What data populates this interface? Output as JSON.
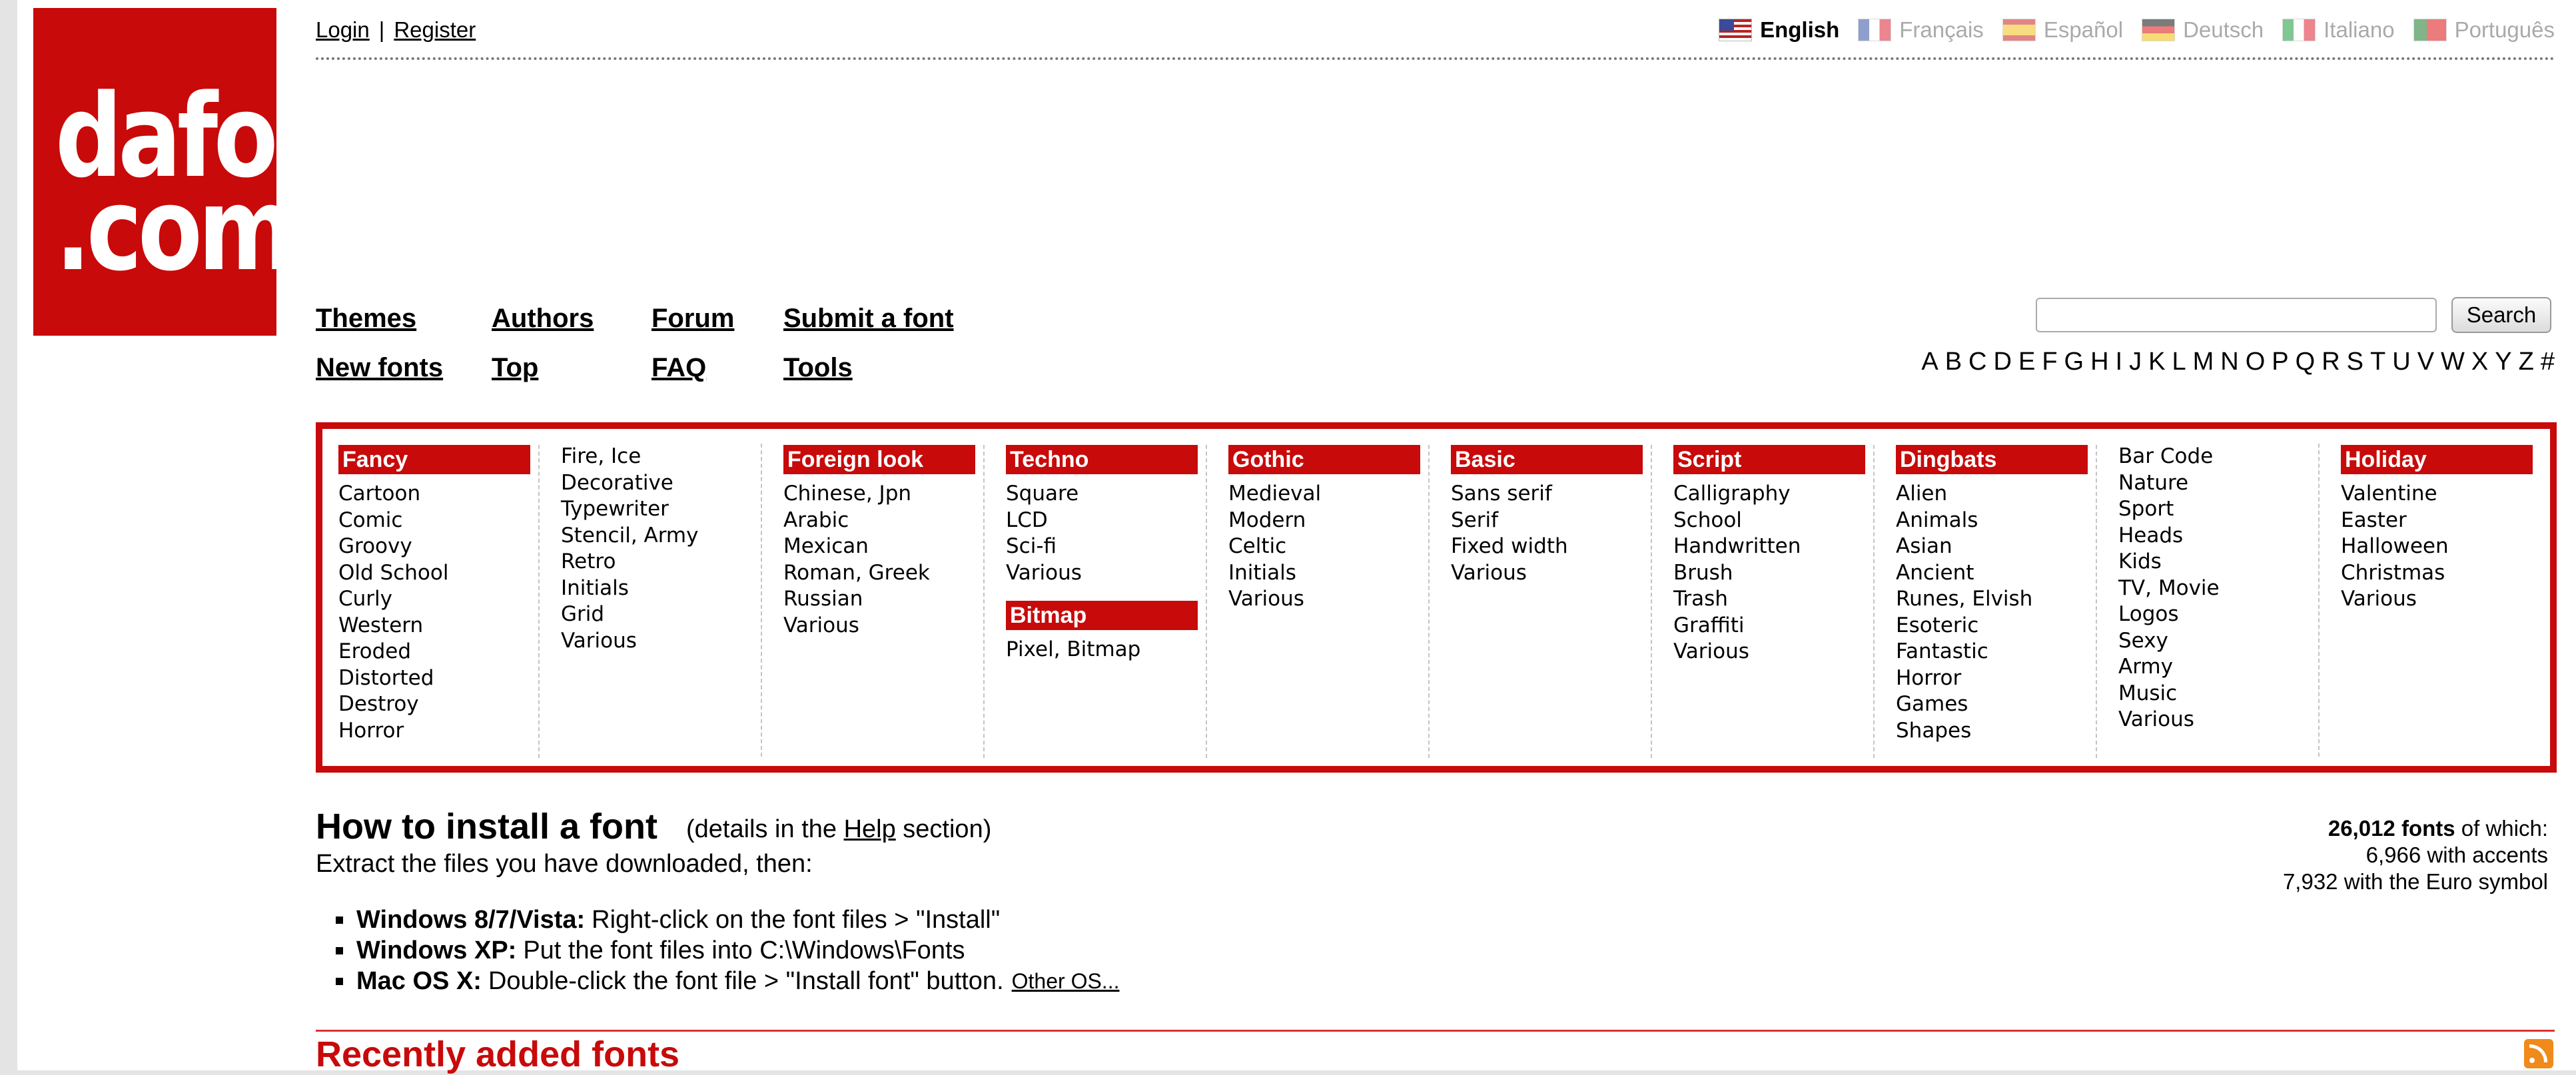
{
  "logo": {
    "line1": "dafont",
    "line2": ".com"
  },
  "top_links": {
    "login": "Login",
    "separator": "|",
    "register": "Register"
  },
  "languages": [
    {
      "name": "English",
      "flag": "us-flag",
      "active": true
    },
    {
      "name": "Français",
      "flag": "fr-flag",
      "active": false
    },
    {
      "name": "Español",
      "flag": "es-flag",
      "active": false
    },
    {
      "name": "Deutsch",
      "flag": "de-flag",
      "active": false
    },
    {
      "name": "Italiano",
      "flag": "it-flag",
      "active": false
    },
    {
      "name": "Português",
      "flag": "pt-flag",
      "active": false
    }
  ],
  "nav": {
    "themes": "Themes",
    "authors": "Authors",
    "forum": "Forum",
    "submit": "Submit a font",
    "new_fonts": "New fonts",
    "top": "Top",
    "faq": "FAQ",
    "tools": "Tools"
  },
  "search": {
    "value": "",
    "button": "Search"
  },
  "alphabet": [
    "A",
    "B",
    "C",
    "D",
    "E",
    "F",
    "G",
    "H",
    "I",
    "J",
    "K",
    "L",
    "M",
    "N",
    "O",
    "P",
    "Q",
    "R",
    "S",
    "T",
    "U",
    "V",
    "W",
    "X",
    "Y",
    "Z",
    "#"
  ],
  "categories": {
    "fancy": {
      "head": "Fancy",
      "items": [
        "Cartoon",
        "Comic",
        "Groovy",
        "Old School",
        "Curly",
        "Western",
        "Eroded",
        "Distorted",
        "Destroy",
        "Horror"
      ]
    },
    "fancy2": {
      "items": [
        "Fire, Ice",
        "Decorative",
        "Typewriter",
        "Stencil, Army",
        "Retro",
        "Initials",
        "Grid",
        "Various"
      ]
    },
    "foreign": {
      "head": "Foreign look",
      "items": [
        "Chinese, Jpn",
        "Arabic",
        "Mexican",
        "Roman, Greek",
        "Russian",
        "Various"
      ]
    },
    "techno": {
      "head": "Techno",
      "items": [
        "Square",
        "LCD",
        "Sci-fi",
        "Various"
      ]
    },
    "bitmap": {
      "head": "Bitmap",
      "items": [
        "Pixel, Bitmap"
      ]
    },
    "gothic": {
      "head": "Gothic",
      "items": [
        "Medieval",
        "Modern",
        "Celtic",
        "Initials",
        "Various"
      ]
    },
    "basic": {
      "head": "Basic",
      "items": [
        "Sans serif",
        "Serif",
        "Fixed width",
        "Various"
      ]
    },
    "script": {
      "head": "Script",
      "items": [
        "Calligraphy",
        "School",
        "Handwritten",
        "Brush",
        "Trash",
        "Graffiti",
        "Various"
      ]
    },
    "dingbats": {
      "head": "Dingbats",
      "items": [
        "Alien",
        "Animals",
        "Asian",
        "Ancient",
        "Runes, Elvish",
        "Esoteric",
        "Fantastic",
        "Horror",
        "Games",
        "Shapes"
      ]
    },
    "dingbats2": {
      "items": [
        "Bar Code",
        "Nature",
        "Sport",
        "Heads",
        "Kids",
        "TV, Movie",
        "Logos",
        "Sexy",
        "Army",
        "Music",
        "Various"
      ]
    },
    "holiday": {
      "head": "Holiday",
      "items": [
        "Valentine",
        "Easter",
        "Halloween",
        "Christmas",
        "Various"
      ]
    }
  },
  "install": {
    "title": "How to install a font",
    "sub_pre": "(details in the",
    "sub_link": "Help",
    "sub_post": "section)",
    "line": "Extract the files you have downloaded, then:",
    "os": [
      {
        "name": "Windows 8/7/Vista:",
        "text": "Right-click on the font files > \"Install\""
      },
      {
        "name": "Windows XP:",
        "text": "Put the font files into C:\\Windows\\Fonts"
      },
      {
        "name": "Mac OS X:",
        "text": "Double-click the font file > \"Install font\" button.",
        "link": "Other OS..."
      }
    ]
  },
  "stats": {
    "count": "26,012 fonts",
    "count_suffix": "of which:",
    "accents": "6,966 with accents",
    "euro": "7,932 with the Euro symbol"
  },
  "recent": {
    "title": "Recently added fonts",
    "rss_icon": "rss-icon"
  },
  "colors": {
    "brand_red": "#c80a0a"
  }
}
